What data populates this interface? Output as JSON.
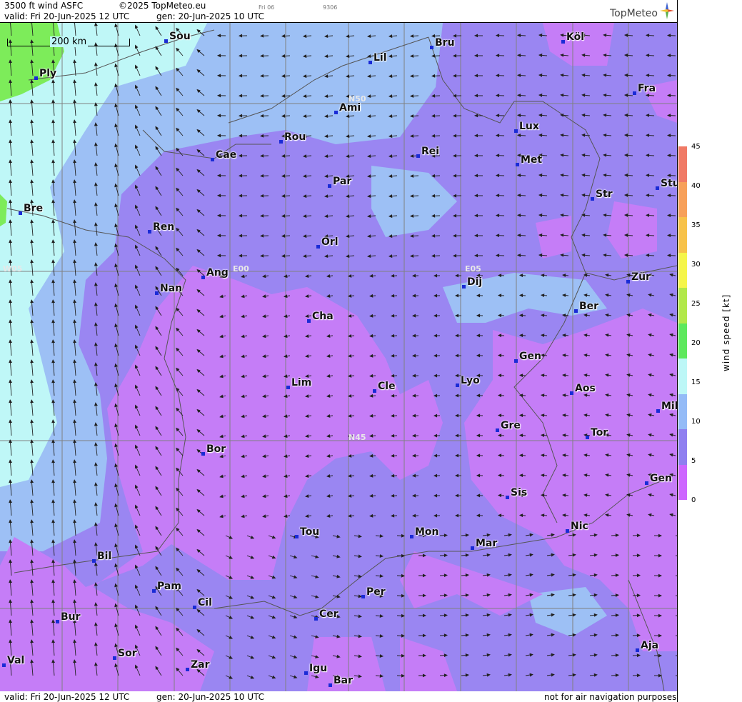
{
  "header": {
    "product": "3500 ft wind ASFC",
    "copyright": "©2025 TopMeteo.eu",
    "day_code": "Fri 06",
    "code2": "9306",
    "valid": "valid:  Fri  20-Jun-2025  12 UTC",
    "gen": "gen: 20-Jun-2025 10 UTC"
  },
  "logo": {
    "text": "TopMeteo",
    "icon": "compass-star-icon"
  },
  "footer": {
    "valid": "valid:  Fri  20-Jun-2025  12 UTC",
    "gen": "gen: 20-Jun-2025 10 UTC",
    "note": "not for air navigation purposes"
  },
  "scale_bar": {
    "label": "200 km"
  },
  "grid_labels": {
    "n50": "N50",
    "n45": "N45",
    "e00": "E00",
    "e05": "E05",
    "w05": "W05"
  },
  "cities": [
    {
      "name": "Sou"
    },
    {
      "name": "Bru"
    },
    {
      "name": "Köl"
    },
    {
      "name": "Lil"
    },
    {
      "name": "Ply"
    },
    {
      "name": "Ami"
    },
    {
      "name": "Fra"
    },
    {
      "name": "Lux"
    },
    {
      "name": "Rou"
    },
    {
      "name": "Cae"
    },
    {
      "name": "Rei"
    },
    {
      "name": "Met"
    },
    {
      "name": "Par"
    },
    {
      "name": "Stu"
    },
    {
      "name": "Str"
    },
    {
      "name": "Bre"
    },
    {
      "name": "Ren"
    },
    {
      "name": "Orl"
    },
    {
      "name": "Ang"
    },
    {
      "name": "Nan"
    },
    {
      "name": "Dij"
    },
    {
      "name": "Zür"
    },
    {
      "name": "Ber"
    },
    {
      "name": "Cha"
    },
    {
      "name": "Gen"
    },
    {
      "name": "Lim"
    },
    {
      "name": "Cle"
    },
    {
      "name": "Lyo"
    },
    {
      "name": "Aos"
    },
    {
      "name": "Mil"
    },
    {
      "name": "Gre"
    },
    {
      "name": "Tor"
    },
    {
      "name": "Bor"
    },
    {
      "name": "Gen"
    },
    {
      "name": "Sis"
    },
    {
      "name": "Tou"
    },
    {
      "name": "Mon"
    },
    {
      "name": "Nic"
    },
    {
      "name": "Mar"
    },
    {
      "name": "Bil"
    },
    {
      "name": "Pam"
    },
    {
      "name": "Cil"
    },
    {
      "name": "Per"
    },
    {
      "name": "Bur"
    },
    {
      "name": "Cer"
    },
    {
      "name": "Sor"
    },
    {
      "name": "Aja"
    },
    {
      "name": "Val"
    },
    {
      "name": "Zar"
    },
    {
      "name": "Igu"
    },
    {
      "name": "Bar"
    }
  ],
  "legend": {
    "title": "wind speed [kt]",
    "ticks": [
      "45",
      "40",
      "35",
      "30",
      "25",
      "20",
      "15",
      "10",
      "5",
      "0"
    ],
    "colors": [
      "#cd66ff",
      "#8f7ff0",
      "#94bbf7",
      "#bdf7f7",
      "#5de85d",
      "#b2e84a",
      "#f5f54a",
      "#f7c24a",
      "#f7a05a",
      "#f07a66"
    ]
  },
  "palette": {
    "band_0_5": "#c57df7",
    "band_5_10": "#9a86f2",
    "band_10_15": "#9dc0f5",
    "band_15_20": "#bff7f7",
    "band_20_25": "#7dec5a"
  }
}
